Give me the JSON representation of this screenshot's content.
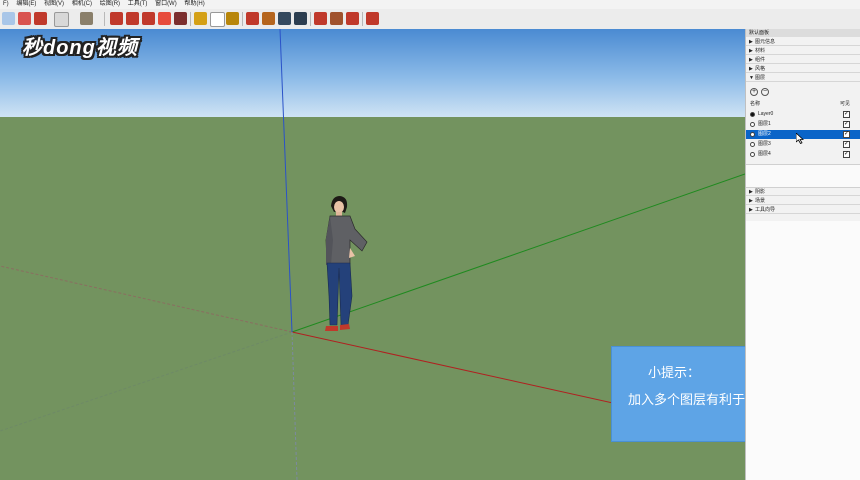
{
  "menu": {
    "items": [
      "F)",
      "编辑(E)",
      "视图(V)",
      "相机(C)",
      "绘图(R)",
      "工具(T)",
      "窗口(W)",
      "帮助(H)"
    ]
  },
  "watermark": "秒dong视频",
  "tip": {
    "title": "小提示：",
    "body": "加入多个图层有利于观察"
  },
  "tray": {
    "title": "默认面板",
    "sections_top": [
      "图元信息",
      "材料",
      "组件",
      "风格",
      "图层"
    ],
    "columns": {
      "name": "名称",
      "visible": "可见"
    },
    "layers": [
      {
        "name": "Layer0",
        "active": true,
        "visible": true,
        "selected": false
      },
      {
        "name": "图层1",
        "active": false,
        "visible": true,
        "selected": false
      },
      {
        "name": "图层2",
        "active": false,
        "visible": true,
        "selected": true
      },
      {
        "name": "图层3",
        "active": false,
        "visible": true,
        "selected": false
      },
      {
        "name": "图层4",
        "active": false,
        "visible": true,
        "selected": false
      }
    ],
    "sections_bottom": [
      "阴影",
      "场景",
      "工具向导"
    ]
  },
  "colors": {
    "sky_top": "#4a8ad2",
    "ground": "#73935f",
    "tip_bg": "#5ea4e6",
    "selection": "#0a64c8"
  }
}
